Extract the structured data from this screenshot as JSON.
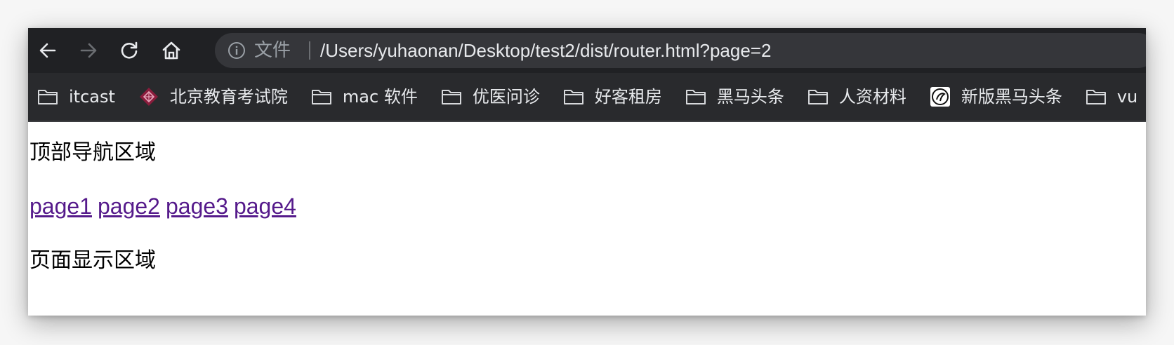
{
  "browser": {
    "security_label": "文件",
    "url": "/Users/yuhaonan/Desktop/test2/dist/router.html?page=2"
  },
  "bookmarks": [
    {
      "label": "itcast",
      "icon": "folder-icon"
    },
    {
      "label": "北京教育考试院",
      "icon": "site-logo-icon"
    },
    {
      "label": "mac 软件",
      "icon": "folder-icon"
    },
    {
      "label": "优医问诊",
      "icon": "folder-icon"
    },
    {
      "label": "好客租房",
      "icon": "folder-icon"
    },
    {
      "label": "黑马头条",
      "icon": "folder-icon"
    },
    {
      "label": "人资材料",
      "icon": "folder-icon"
    },
    {
      "label": "新版黑马头条",
      "icon": "site-logo-icon"
    },
    {
      "label": "vu",
      "icon": "folder-icon"
    }
  ],
  "page": {
    "top_nav_text": "顶部导航区域",
    "links": [
      "page1",
      "page2",
      "page3",
      "page4"
    ],
    "display_text": "页面显示区域"
  },
  "colors": {
    "toolbar": "#202124",
    "bookmarks_bar": "#292a2d",
    "visited_link": "#551a8b"
  }
}
